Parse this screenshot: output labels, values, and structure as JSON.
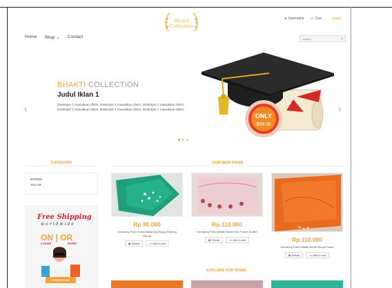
{
  "header": {
    "user_label": "Username",
    "cart_label": "Cart",
    "login_label": "Login",
    "search_placeholder": "Search"
  },
  "nav": {
    "items": [
      {
        "label": "Home"
      },
      {
        "label": "Shop ⌄"
      },
      {
        "label": "Contact"
      }
    ]
  },
  "slider": {
    "brand_word1": "BHAKTI",
    "brand_word2": " COLLECTION",
    "ad_title": "Judul Iklan 1",
    "ad_description": "Deskripsi 1 masukkan disini. Deskripsi 1 masukkan disini. Deskripsi 1 masukkan disini. Deskripsi 1 masukkan disini. Deskripsi 1 masukkan disini. Deskripsi 1 masukkan disini.",
    "prev_arrow": "‹",
    "next_arrow": "›",
    "badge_only": "ONLY",
    "badge_price": "$99.00",
    "active_dot": 1,
    "dot_count": 3
  },
  "sidebar": {
    "category_title": "CATEGORY",
    "categories": [
      {
        "label": "BORDIR"
      },
      {
        "label": "SULAM"
      }
    ],
    "promo": {
      "line1": "Free Shipping",
      "line2": "worldwide",
      "line3a": "ON",
      "line3b": "OR",
      "line4a": "2 PAIRS",
      "line4b": "MORE!",
      "order_button": "ORDER NOW"
    }
  },
  "products_section": {
    "title": "OUR NEW ITEMS",
    "details_label": "Details",
    "cart_label": "Add to cart",
    "items": [
      {
        "price": "Rp.90.000",
        "name": "Kerudung Paris Sulam Balakang Bunga Ranting Ramai"
      },
      {
        "price": "Rp.110.000",
        "name": "Kerudung Paris Affafah Bordir Mini Flower Butterf"
      },
      {
        "price": "Rp.110.000",
        "name": "Kerudung Paris Affafah Bordir Bunga Sudut"
      }
    ],
    "explore_label": "EXPLORE FOR MORE"
  },
  "colors": {
    "accent": "#f2a43a",
    "red": "#d81c2c"
  }
}
